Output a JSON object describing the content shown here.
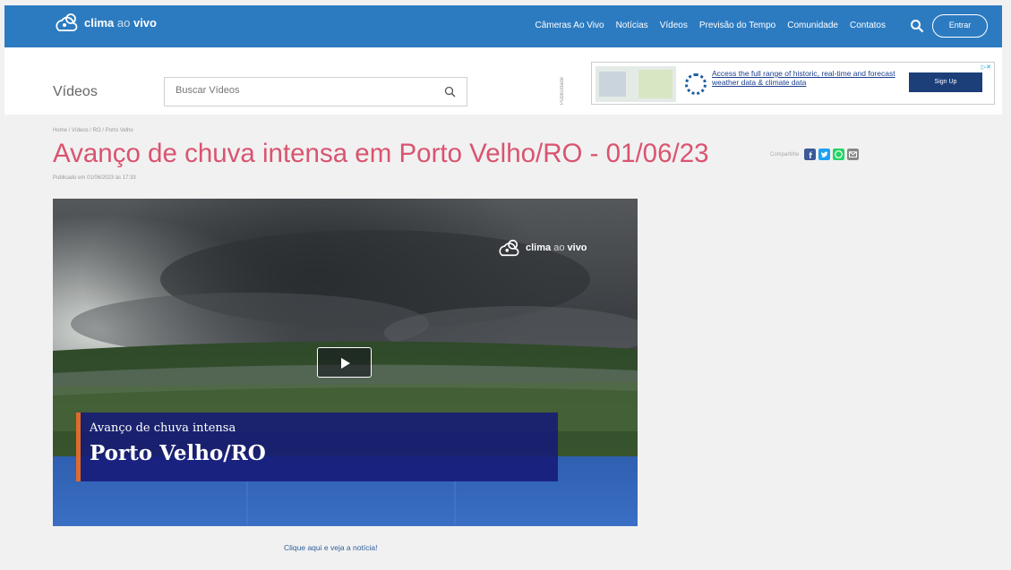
{
  "header": {
    "brand": {
      "word1": "clima",
      "word2": "ao",
      "word3": "vivo"
    },
    "nav_items": [
      "Câmeras Ao Vivo",
      "Notícias",
      "Vídeos",
      "Previsão do Tempo",
      "Comunidade",
      "Contatos"
    ],
    "login_label": "Entrar"
  },
  "subheader": {
    "section_title": "Vídeos",
    "search_placeholder": "Buscar Vídeos",
    "ad_side_label": "Publicidade"
  },
  "ad": {
    "text": "Access the full range of historic, real-time and forecast weather data & climate data",
    "button_label": "Sign Up"
  },
  "article": {
    "breadcrumb": "Home / Vídeos / RO / Porto Velho",
    "title": "Avanço de chuva intensa em Porto Velho/RO - 01/06/23",
    "share_label": "Compartilhe",
    "published": "Publicado em 01/06/2023 às 17:33"
  },
  "video": {
    "watermark": {
      "word1": "clima",
      "word2": "ao",
      "word3": "vivo"
    },
    "caption_line1": "Avanço de chuva intensa",
    "caption_line2": "Porto Velho/RO"
  },
  "cta": "Clique aqui e veja a notícia!",
  "colors": {
    "topbar": "#2c7bc1",
    "headline": "#d9546f",
    "facebook": "#3b5998",
    "twitter": "#1da1f2",
    "whatsapp": "#25d366",
    "email": "#888888",
    "caption_bg": "#161a78",
    "caption_accent": "#e06a2a"
  },
  "icons": [
    "cloud-sun-logo-icon",
    "search-icon",
    "play-icon",
    "facebook-icon",
    "twitter-icon",
    "whatsapp-icon",
    "email-icon"
  ]
}
